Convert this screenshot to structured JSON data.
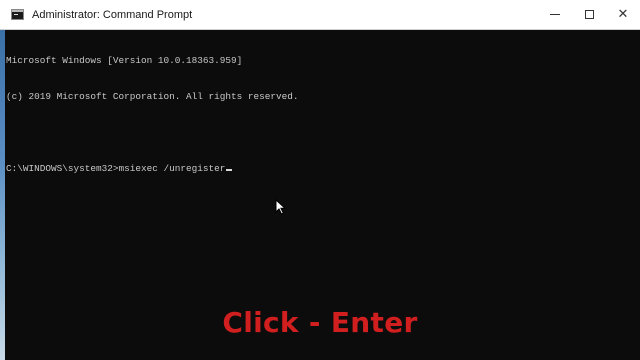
{
  "window": {
    "title": "Administrator: Command Prompt",
    "close_glyph": "✕"
  },
  "console": {
    "line1": "Microsoft Windows [Version 10.0.18363.959]",
    "line2": "(c) 2019 Microsoft Corporation. All rights reserved.",
    "line3": "",
    "prompt": "C:\\WINDOWS\\system32>",
    "command": "msiexec /unregister"
  },
  "overlay": {
    "caption": "Click - Enter"
  },
  "colors": {
    "console_bg": "#0c0c0c",
    "console_text": "#c8c8c8",
    "caption": "#d11f1f",
    "titlebar_bg": "#ffffff"
  },
  "icons": {
    "app": "command-prompt-icon",
    "minimize": "minimize-icon",
    "maximize": "maximize-icon",
    "close": "close-icon",
    "pointer": "mouse-pointer-icon"
  }
}
